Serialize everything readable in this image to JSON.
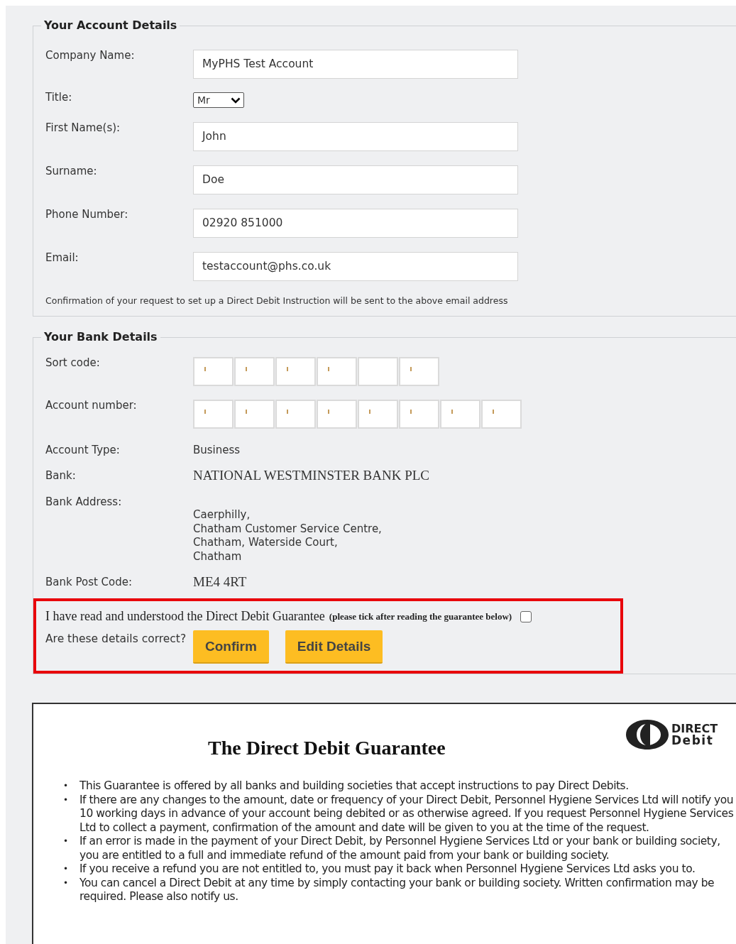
{
  "account_details": {
    "legend": "Your Account Details",
    "fields": [
      {
        "kind": "text",
        "label": "Company Name:",
        "value": "MyPHS Test Account"
      },
      {
        "kind": "select",
        "label": "Title:",
        "value": "Mr"
      },
      {
        "kind": "text",
        "label": "First Name(s):",
        "value": "John"
      },
      {
        "kind": "text",
        "label": "Surname:",
        "value": "Doe"
      },
      {
        "kind": "text",
        "label": "Phone Number:",
        "value": "02920 851000"
      },
      {
        "kind": "text",
        "label": "Email:",
        "value": "testaccount@phs.co.uk"
      }
    ],
    "note": "Confirmation of your request to set up a Direct Debit Instruction will be sent to the above email address"
  },
  "bank_details": {
    "legend": "Your Bank Details",
    "rows": [
      {
        "kind": "boxes",
        "label": "Sort code:",
        "boxes": [
          {
            "obscured": true
          },
          {
            "obscured": true
          },
          {
            "obscured": true
          },
          {
            "obscured": true
          },
          {
            "obscured": false
          },
          {
            "obscured": true
          }
        ]
      },
      {
        "kind": "boxes",
        "label": "Account number:",
        "boxes": [
          {
            "obscured": true
          },
          {
            "obscured": true
          },
          {
            "obscured": true
          },
          {
            "obscured": true
          },
          {
            "obscured": true
          },
          {
            "obscured": true
          },
          {
            "obscured": true
          },
          {
            "obscured": true
          }
        ]
      },
      {
        "kind": "text",
        "label": "Account Type:",
        "value": "Business"
      },
      {
        "kind": "serif",
        "label": "Bank:",
        "value": "NATIONAL WESTMINSTER BANK PLC"
      },
      {
        "kind": "address",
        "label": "Bank Address:",
        "lines": [
          "Caerphilly,",
          "Chatham Customer Service Centre,",
          "Chatham, Waterside Court,",
          "Chatham"
        ]
      },
      {
        "kind": "serif",
        "label": "Bank Post Code:",
        "value": "ME4 4RT"
      }
    ]
  },
  "confirmation": {
    "highlighted": true,
    "guarantee_label": "I have read and understood the Direct Debit Guarantee",
    "guarantee_hint": "(please tick after reading the guarantee below)",
    "checked": false,
    "question": "Are these details correct?",
    "buttons": [
      "Confirm",
      "Edit Details"
    ]
  },
  "guarantee": {
    "title": "The Direct Debit Guarantee",
    "logo": [
      "DIRECT",
      "Debit"
    ],
    "bullet": "•",
    "items": [
      "This Guarantee is offered by all banks and building societies that accept instructions to pay Direct Debits.",
      "If there are any changes to the amount, date or frequency of your Direct Debit, Personnel Hygiene Services Ltd will notify you 10 working days in advance of your account being debited or as otherwise agreed. If you request Personnel Hygiene Services Ltd to collect a payment, confirmation of the amount and date will be given to you at the time of the request.",
      "If an error is made in the payment of your Direct Debit, by Personnel Hygiene Services Ltd or your bank or building society, you are entitled to a full and immediate refund of the amount paid from your bank or building society.",
      "If you receive a refund you are not entitled to, you must pay it back when Personnel Hygiene Services Ltd asks you to.",
      "You can cancel a Direct Debit at any time by simply contacting your bank or building society. Written confirmation may be required. Please also notify us."
    ]
  }
}
